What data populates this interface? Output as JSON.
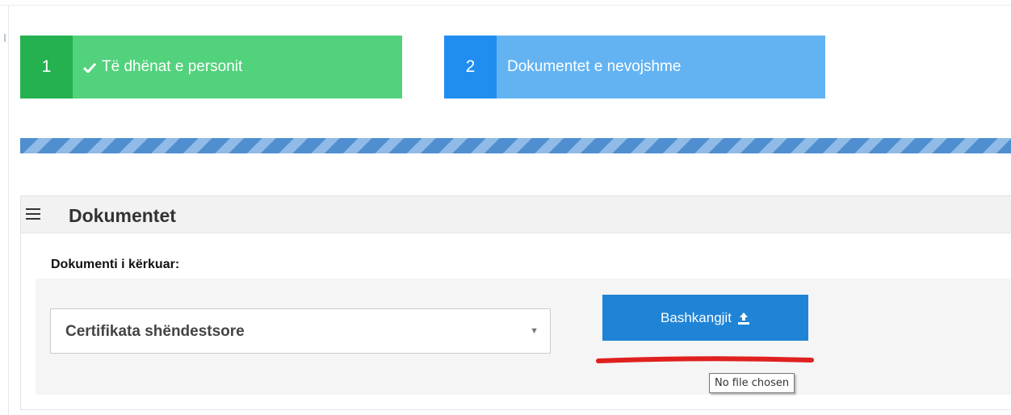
{
  "steps": [
    {
      "number": "1",
      "label": "Të dhënat e personit",
      "icon": "check-icon",
      "completed": true
    },
    {
      "number": "2",
      "label": "Dokumentet e nevojshme",
      "completed": false
    }
  ],
  "panel": {
    "icon": "menu-icon",
    "title": "Dokumentet",
    "field_label": "Dokumenti i kërkuar:",
    "select_value": "Certifikata shëndestsore",
    "attach_label": "Bashkangjit",
    "attach_icon": "upload-icon",
    "tooltip": "No file chosen"
  },
  "colors": {
    "step_done": "#52d27c",
    "step_done_number": "#25b14f",
    "step_active": "#63b3f3",
    "step_active_number": "#1f8ef0",
    "button": "#1f84d6",
    "annotation": "#e0201f"
  }
}
